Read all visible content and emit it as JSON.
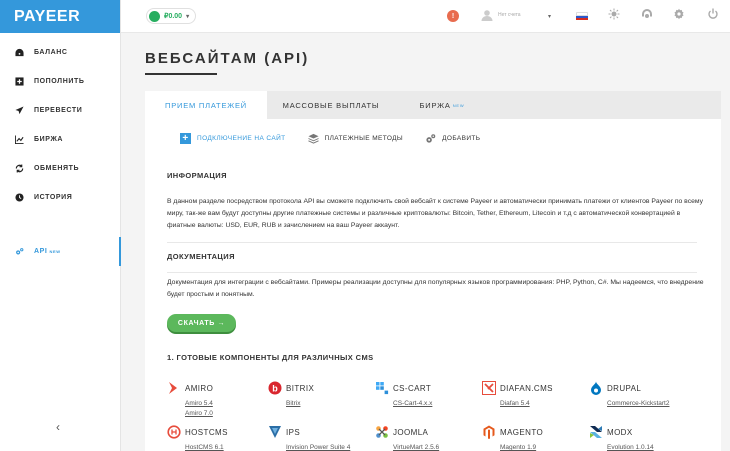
{
  "logo": "PAYEER",
  "sidebar": {
    "items": [
      {
        "label": "БАЛАНС",
        "icon": "dashboard-icon"
      },
      {
        "label": "ПОПОЛНИТЬ",
        "icon": "plus-square-icon"
      },
      {
        "label": "ПЕРЕВЕСТИ",
        "icon": "send-icon"
      },
      {
        "label": "БИРЖА",
        "icon": "chart-icon"
      },
      {
        "label": "ОБМЕНЯТЬ",
        "icon": "exchange-icon"
      },
      {
        "label": "ИСТОРИЯ",
        "icon": "clock-icon"
      }
    ],
    "api": {
      "label": "API",
      "new": "NEW"
    },
    "collapse": "‹"
  },
  "header": {
    "balance": "₽0.00",
    "notifications": "!",
    "user_placeholder": "Нет счета",
    "language": "ru"
  },
  "page": {
    "title": "ВЕБСАЙТАМ (API)",
    "tabs": [
      {
        "label": "ПРИЕМ ПЛАТЕЖЕЙ"
      },
      {
        "label": "МАССОВЫЕ ВЫПЛАТЫ"
      },
      {
        "label": "БИРЖА",
        "new": "NEW"
      }
    ],
    "subnav": [
      {
        "label": "ПОДКЛЮЧЕНИЕ НА САЙТ"
      },
      {
        "label": "ПЛАТЕЖНЫЕ МЕТОДЫ"
      },
      {
        "label": "ДОБАВИТЬ"
      }
    ],
    "info_title": "ИНФОРМАЦИЯ",
    "info_text": "В данном разделе посредством протокола API вы сможете подключить свой вебсайт к системе Payeer и автоматически принимать платежи от клиентов Payeer по всему миру, так-же вам будут доступны другие платежные системы и различные криптовалюты: Bitcoin, Tether, Ethereum, Litecoin и т.д с автоматической конвертацией в фиатные валюты: USD, EUR, RUB и зачислением на ваш Payeer аккаунт.",
    "doc_title": "ДОКУМЕНТАЦИЯ",
    "doc_text": "Документация для интеграции с вебсайтами. Примеры реализации доступны для популярных языков программирования: PHP, Python, C#. Мы надеемся, что внедрение будет простым и понятным.",
    "download": "СКАЧАТЬ →",
    "cms_title": "1. ГОТОВЫЕ КОМПОНЕНТЫ ДЛЯ РАЗЛИЧНЫХ CMS",
    "cms": [
      {
        "name": "AMIRO",
        "links": [
          "Amiro 5.4",
          "Amiro 7.0"
        ],
        "color": "#e74c3c"
      },
      {
        "name": "BITRIX",
        "links": [
          "Bitrix"
        ],
        "color": "#d9262e"
      },
      {
        "name": "CS-CART",
        "links": [
          "CS-Cart-4.x.x"
        ],
        "color": "#3fa9f5"
      },
      {
        "name": "DIAFAN.CMS",
        "links": [
          "Diafan 5.4"
        ],
        "color": "#e74c3c"
      },
      {
        "name": "DRUPAL",
        "links": [
          "Commerce-Kickstart2"
        ],
        "color": "#0077c0"
      },
      {
        "name": "HOSTCMS",
        "links": [
          "HostCMS 6.1"
        ],
        "color": "#e74c3c"
      },
      {
        "name": "IPS",
        "links": [
          "Invision Power Suite 4"
        ],
        "color": "#2b6ea6"
      },
      {
        "name": "JOOMLA",
        "links": [
          "VirtueMart 2.5.6"
        ],
        "color": "#f44321"
      },
      {
        "name": "MAGENTO",
        "links": [
          "Magento 1.9"
        ],
        "color": "#e5591c"
      },
      {
        "name": "MODX",
        "links": [
          "Evolution 1.0.14"
        ],
        "color": "#102c53"
      }
    ]
  }
}
